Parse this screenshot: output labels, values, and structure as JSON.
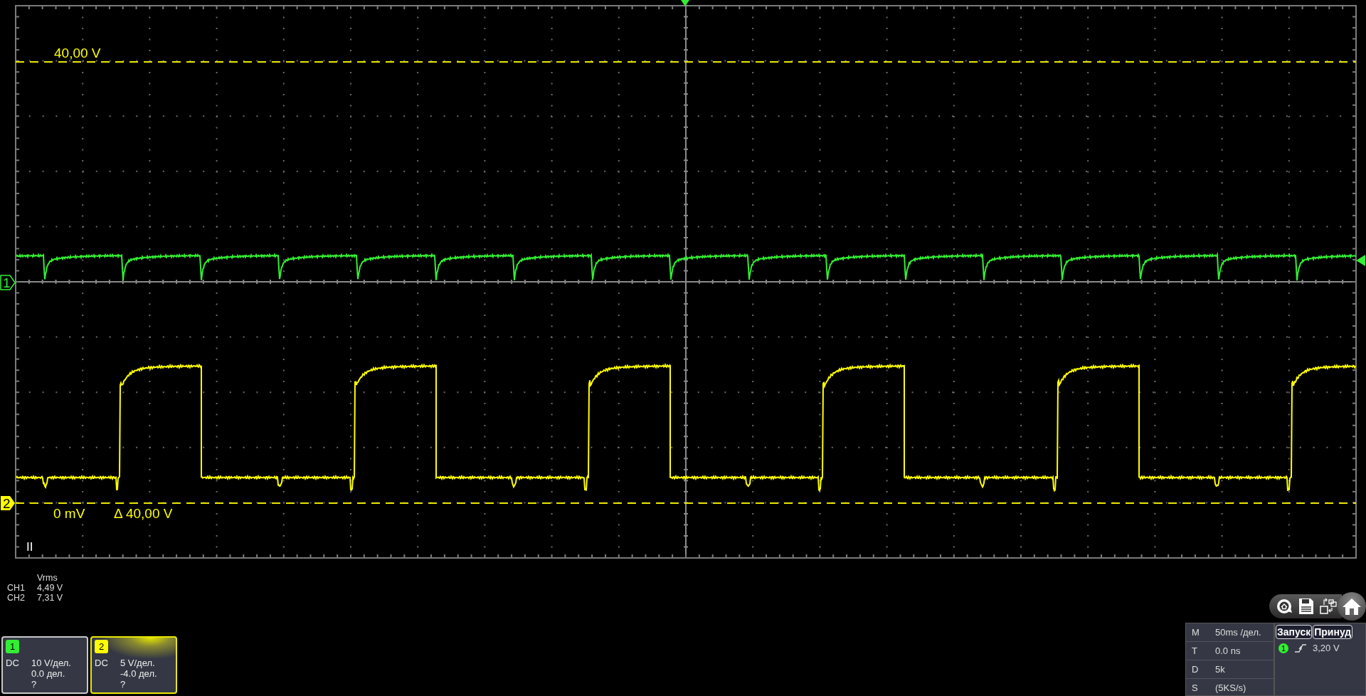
{
  "screen": {
    "cursor_labels": [
      {
        "kind": "top",
        "text": "40,00 V"
      },
      {
        "kind": "bottom",
        "text": "0 mV"
      },
      {
        "kind": "delta",
        "text": "Δ 40,00 V"
      }
    ],
    "channel_markers": [
      {
        "label": "1",
        "color": "#33ee33",
        "selected": false
      },
      {
        "label": "2",
        "color": "#ffff00",
        "selected": true
      }
    ],
    "status": "II"
  },
  "measurements": {
    "header": "Vrms",
    "rows": [
      {
        "channel": "CH1",
        "value": "4,49 V"
      },
      {
        "channel": "CH2",
        "value": "7,31 V"
      }
    ]
  },
  "channels": [
    {
      "number": "1",
      "color": "#33ee33",
      "coupling": "DC",
      "scale": "10 V/дел.",
      "offset": "0.0 дел.",
      "probe": "?",
      "selected": false
    },
    {
      "number": "2",
      "color": "#ffff00",
      "coupling": "DC",
      "scale": "5 V/дел.",
      "offset": "-4.0 дел.",
      "probe": "?",
      "selected": true
    }
  ],
  "timebase": [
    {
      "key": "M",
      "value": "50ms /дел."
    },
    {
      "key": "T",
      "value": "0.0 ns"
    },
    {
      "key": "D",
      "value": "5k"
    },
    {
      "key": "S",
      "value": "(5KS/s)"
    }
  ],
  "trigger": {
    "buttons": [
      "Запуск",
      "Принуд"
    ],
    "source": "1",
    "level": "3,20 V"
  }
}
